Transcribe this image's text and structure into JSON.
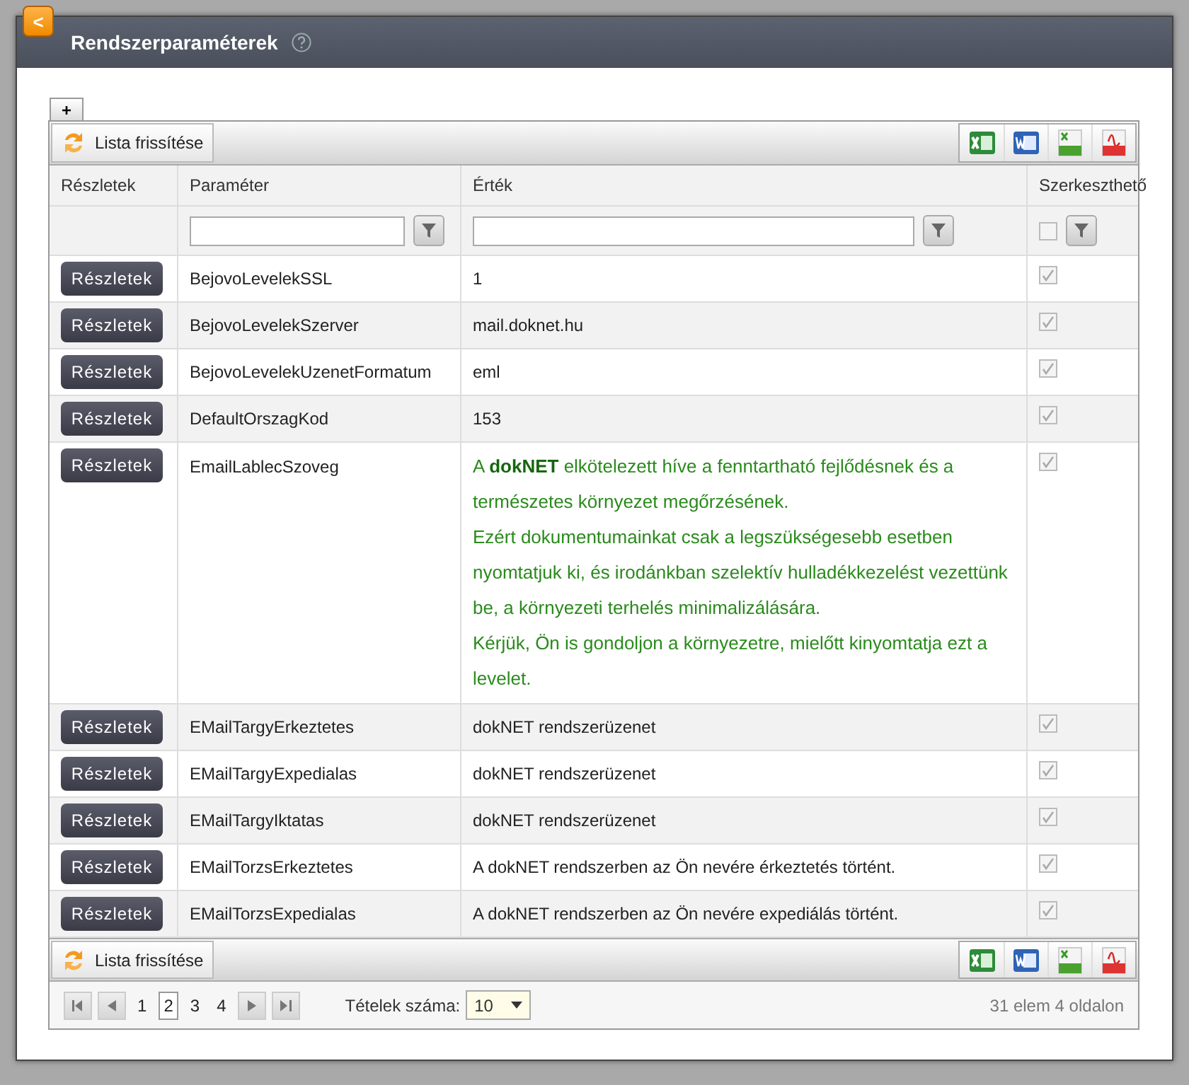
{
  "window": {
    "title": "Rendszerparaméterek",
    "back_icon": "<"
  },
  "add_tab": "+",
  "toolbar": {
    "refresh": "Lista frissítése"
  },
  "table": {
    "columns": [
      "Részletek",
      "Paraméter",
      "Érték",
      "Szerkeszthető"
    ],
    "filters": {
      "editable_checked": false
    },
    "rows": [
      {
        "button": "Részletek",
        "name": "BejovoLevelekSSL",
        "kind": "plain",
        "value": [
          "1"
        ],
        "editable": true
      },
      {
        "button": "Részletek",
        "name": "BejovoLevelekSzerver",
        "kind": "plain",
        "value": [
          "mail.doknet.hu"
        ],
        "editable": true
      },
      {
        "button": "Részletek",
        "name": "BejovoLevelekUzenetFormatum",
        "kind": "plain",
        "value": [
          "eml"
        ],
        "editable": true
      },
      {
        "button": "Részletek",
        "name": "DefaultOrszagKod",
        "kind": "plain",
        "value": [
          "153"
        ],
        "editable": true
      },
      {
        "button": "Részletek",
        "name": "EmailLablecSzoveg",
        "kind": "green",
        "value": [
          "A **dokNET** elkötelezett híve a fenntartható fejlődésnek és a természetes környezet megőrzésének.",
          "Ezért dokumentumainkat csak a legszükségesebb esetben nyomtatjuk ki, és irodánkban szelektív hulladékkezelést vezettünk be, a környezeti terhelés minimalizálására.",
          "Kérjük, Ön is gondoljon a környezetre, mielőtt kinyomtatja ezt a levelet."
        ],
        "editable": true
      },
      {
        "button": "Részletek",
        "name": "EMailTargyErkeztetes",
        "kind": "plain",
        "value": [
          "dokNET rendszerüzenet"
        ],
        "editable": true
      },
      {
        "button": "Részletek",
        "name": "EMailTargyExpedialas",
        "kind": "plain",
        "value": [
          "dokNET rendszerüzenet"
        ],
        "editable": true
      },
      {
        "button": "Részletek",
        "name": "EMailTargyIktatas",
        "kind": "plain",
        "value": [
          "dokNET rendszerüzenet"
        ],
        "editable": true
      },
      {
        "button": "Részletek",
        "name": "EMailTorzsErkeztetes",
        "kind": "plain",
        "value": [
          "A dokNET rendszerben az Ön nevére érkeztetés történt."
        ],
        "editable": true
      },
      {
        "button": "Részletek",
        "name": "EMailTorzsExpedialas",
        "kind": "plain",
        "value": [
          "A dokNET rendszerben az Ön nevére expediálás történt."
        ],
        "editable": true
      }
    ]
  },
  "bottom_toolbar": {
    "refresh": "Lista frissítése"
  },
  "pager": {
    "pages": [
      {
        "label": "1",
        "selected": false
      },
      {
        "label": "2",
        "selected": true
      },
      {
        "label": "3",
        "selected": false
      },
      {
        "label": "4",
        "selected": false
      }
    ],
    "page_size_label": "Tételek száma:",
    "page_size": "10",
    "summary": "31 elem 4 oldalon"
  }
}
